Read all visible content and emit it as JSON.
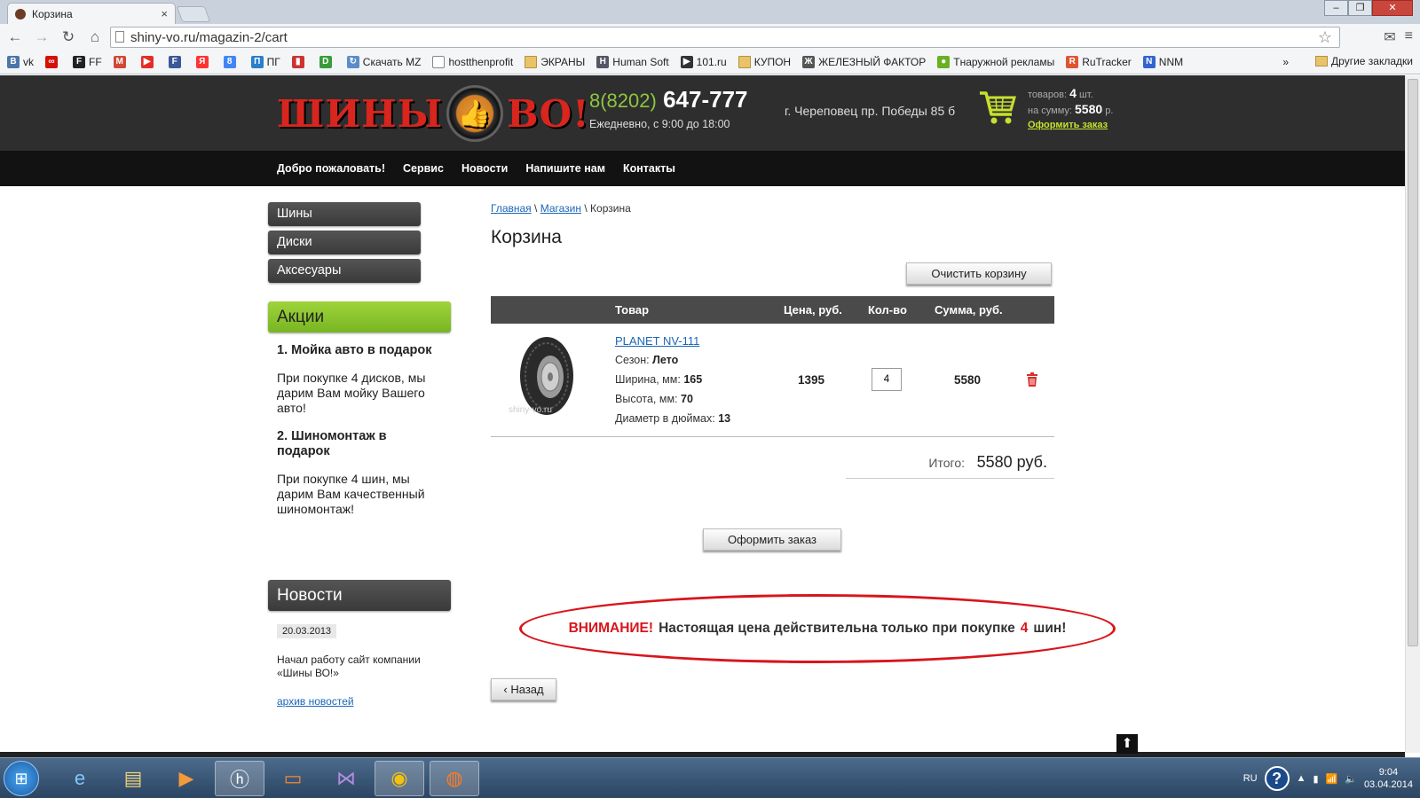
{
  "browser": {
    "tab_title": "Корзина",
    "tab_close": "×",
    "url": "shiny-vo.ru/magazin-2/cart",
    "bookmarks": [
      {
        "label": "vk",
        "icon": "vk-icon",
        "color": "#4a76a8",
        "glyph": "B"
      },
      {
        "label": "",
        "icon": "lastfm-icon",
        "color": "#d51007",
        "glyph": "∞"
      },
      {
        "label": "FF",
        "icon": "ff-icon",
        "color": "#222",
        "glyph": "F"
      },
      {
        "label": "",
        "icon": "gmail-icon",
        "color": "#d14836",
        "glyph": "M"
      },
      {
        "label": "",
        "icon": "youtube-icon",
        "color": "#e52d27",
        "glyph": "▶"
      },
      {
        "label": "",
        "icon": "f-icon",
        "color": "#3b5998",
        "glyph": "F"
      },
      {
        "label": "",
        "icon": "yandex-icon",
        "color": "#f33",
        "glyph": "Я"
      },
      {
        "label": "",
        "icon": "google-icon",
        "color": "#4285f4",
        "glyph": "8"
      },
      {
        "label": "ПГ",
        "icon": "pg-icon",
        "color": "#2a7fc8",
        "glyph": "П"
      },
      {
        "label": "",
        "icon": "stats-icon",
        "color": "#c33",
        "glyph": "▮"
      },
      {
        "label": "",
        "icon": "mz-icon",
        "color": "#3a9b3a",
        "glyph": "D"
      },
      {
        "label": "Скачать MZ",
        "icon": "download-icon",
        "color": "#5b8cc8",
        "glyph": "↻"
      },
      {
        "label": "hostthenprofit",
        "icon": "page-icon",
        "color": "",
        "glyph": ""
      },
      {
        "label": "ЭКРАНЫ",
        "icon": "folder-icon",
        "color": "",
        "glyph": ""
      },
      {
        "label": "Human Soft",
        "icon": "hs-icon",
        "color": "#556",
        "glyph": "H"
      },
      {
        "label": "101.ru",
        "icon": "play-icon",
        "color": "#333",
        "glyph": "▶"
      },
      {
        "label": "КУПОН",
        "icon": "folder-icon",
        "color": "",
        "glyph": ""
      },
      {
        "label": "ЖЕЛЕЗНЫЙ ФАКТОР",
        "icon": "factor-icon",
        "color": "#555",
        "glyph": "Ж"
      },
      {
        "label": "Тнаружной рекламы",
        "icon": "leaf-icon",
        "color": "#6ab023",
        "glyph": "●"
      },
      {
        "label": "RuTracker",
        "icon": "rutracker-icon",
        "color": "#d53",
        "glyph": "R"
      },
      {
        "label": "NNM",
        "icon": "nnm-icon",
        "color": "#36c",
        "glyph": "N"
      }
    ],
    "bookmarks_more": "»",
    "other_bookmarks": "Другие закладки"
  },
  "site": {
    "logo_left": "ШИНЫ",
    "logo_right": "ВО!",
    "phone_prefix": "8(8202)",
    "phone_number": "647-777",
    "hours": "Ежедневно, с 9:00 до 18:00",
    "address": "г. Череповец пр. Победы 85 б",
    "cart": {
      "items_label": "товаров:",
      "items_count": "4",
      "items_unit": "шт.",
      "sum_label": "на сумму:",
      "sum_value": "5580",
      "sum_unit": "р.",
      "checkout_link": "Оформить заказ"
    },
    "nav": [
      "Добро пожаловать!",
      "Сервис",
      "Новости",
      "Напишите нам",
      "Контакты"
    ]
  },
  "sidebar": {
    "categories": [
      "Шины",
      "Диски",
      "Аксесуары"
    ],
    "promo_title": "Акции",
    "promos": [
      {
        "title": "1. Мойка авто в подарок",
        "text": "При покупке 4 дисков, мы дарим Вам мойку Вашего авто!"
      },
      {
        "title": "2. Шиномонтаж в подарок",
        "text": "При покупке 4 шин, мы дарим Вам качественный шиномонтаж!"
      }
    ],
    "news_title": "Новости",
    "news_date": "20.03.2013",
    "news_text": "Начал работу сайт компании «Шины ВО!»",
    "news_archive": "архив новостей"
  },
  "cart_page": {
    "breadcrumb": {
      "home": "Главная",
      "sep": "\\",
      "shop": "Магазин",
      "current": "Корзина"
    },
    "title": "Корзина",
    "clear_button": "Очистить корзину",
    "columns": {
      "product": "Товар",
      "price": "Цена, руб.",
      "qty": "Кол-во",
      "sum": "Сумма, руб."
    },
    "item": {
      "name": "PLANET NV-111",
      "watermark": "shiny-vo.ru",
      "season_label": "Сезон:",
      "season": "Лето",
      "width_label": "Ширина, мм:",
      "width": "165",
      "height_label": "Высота, мм:",
      "height": "70",
      "diameter_label": "Диаметр в дюймах:",
      "diameter": "13",
      "price": "1395",
      "qty": "4",
      "sum": "5580"
    },
    "total_label": "Итого:",
    "total_value": "5580 руб.",
    "order_button": "Оформить заказ",
    "warning": {
      "prefix": "ВНИМАНИЕ!",
      "text": "Настоящая цена действительна только при покупке",
      "number": "4",
      "suffix": "шин!"
    },
    "back_button": "Назад"
  },
  "taskbar": {
    "lang": "RU",
    "time": "9:04",
    "date": "03.04.2014"
  }
}
